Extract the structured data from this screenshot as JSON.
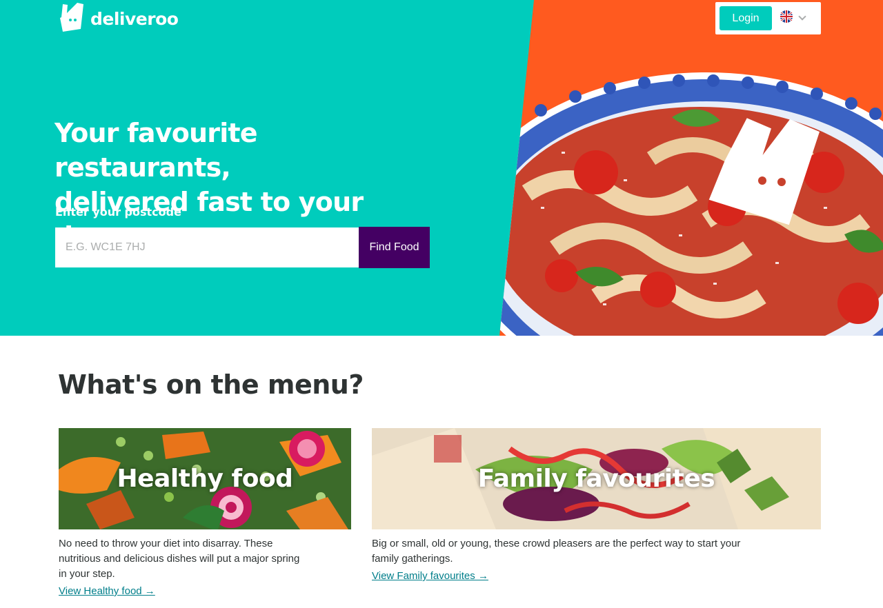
{
  "brand": {
    "name": "deliveroo",
    "logo_icon": "kangaroo-icon"
  },
  "header": {
    "login_label": "Login",
    "language_icon": "uk-flag-icon"
  },
  "hero": {
    "headline_line1": "Your favourite restaurants,",
    "headline_line2": "delivered fast to your door.",
    "postcode_label": "Enter your postcode",
    "postcode_placeholder": "E.G. WC1E 7HJ",
    "postcode_value": "",
    "find_button_label": "Find Food"
  },
  "menu": {
    "title": "What's on the menu?",
    "cards": [
      {
        "title": "Healthy food",
        "description_lines": [
          "No need to throw your diet into disarray. These",
          "nutritious and delicious dishes will put a major spring",
          "in your step."
        ],
        "link": "View Healthy food →"
      },
      {
        "title": "Family favourites",
        "description_lines": [
          "Big or small, old or young, these crowd pleasers are the perfect way to start your",
          "family gatherings."
        ],
        "link": "View Family favourites →"
      }
    ]
  },
  "colors": {
    "teal": "#00ccbc",
    "purple": "#440063",
    "link": "#007e8a",
    "text": "#2e3333"
  }
}
